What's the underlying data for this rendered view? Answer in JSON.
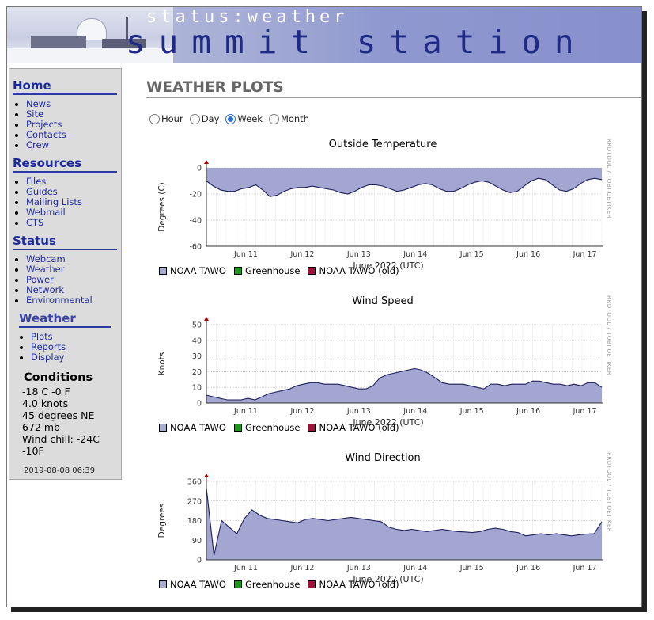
{
  "header": {
    "top_text": "status:weather",
    "main_text": "summit station"
  },
  "sidebar": {
    "home": {
      "title": "Home",
      "items": [
        "News",
        "Site",
        "Projects",
        "Contacts",
        "Crew"
      ]
    },
    "resources": {
      "title": "Resources",
      "items": [
        "Files",
        "Guides",
        "Mailing Lists",
        "Webmail",
        "CTS"
      ]
    },
    "status": {
      "title": "Status",
      "items": [
        "Webcam",
        "Weather",
        "Power",
        "Network",
        "Environmental"
      ]
    },
    "weather": {
      "title": "Weather",
      "items": [
        "Plots",
        "Reports",
        "Display"
      ]
    },
    "conditions": {
      "title": "Conditions",
      "lines": [
        "-18 C -0 F",
        "4.0 knots",
        "45 degrees NE",
        "672 mb",
        "Wind chill: -24C",
        "-10F"
      ],
      "date": "2019-08-08 06:39"
    }
  },
  "main": {
    "title": "WEATHER PLOTS",
    "ranges": [
      "Hour",
      "Day",
      "Week",
      "Month"
    ],
    "selected_range": "Week"
  },
  "legend": {
    "items": [
      "NOAA TAWO",
      "Greenhouse",
      "NOAA TAWO (old)"
    ],
    "colors": [
      "#a8acd0",
      "#1a9a1a",
      "#a0103a"
    ]
  },
  "watermark": "RRDTOOL / TOBI OETIKER",
  "colors": {
    "area": "#a3a6d1",
    "line": "#1c1f5c",
    "grid": "#d9d9d9"
  },
  "chart_data": [
    {
      "type": "area",
      "title": "Outside Temperature",
      "ylabel": "Degrees (C)",
      "xlabel": "June 2022 (UTC)",
      "categories": [
        "Jun 11",
        "Jun 12",
        "Jun 13",
        "Jun 14",
        "Jun 15",
        "Jun 16",
        "Jun 17"
      ],
      "yticks": [
        "0",
        "-20",
        "-40",
        "-60"
      ],
      "ylim": [
        -60,
        0
      ],
      "area_from": "top",
      "series": [
        {
          "name": "NOAA TAWO",
          "values": [
            -10,
            -14,
            -17,
            -18,
            -18,
            -16,
            -15,
            -13,
            -17,
            -22,
            -21,
            -18,
            -16,
            -15,
            -15,
            -14,
            -15,
            -16,
            -17,
            -19,
            -20,
            -18,
            -15,
            -13,
            -13,
            -14,
            -16,
            -18,
            -17,
            -15,
            -13,
            -12,
            -13,
            -16,
            -18,
            -18,
            -16,
            -13,
            -11,
            -10,
            -11,
            -14,
            -17,
            -19,
            -18,
            -14,
            -10,
            -8,
            -9,
            -13,
            -17,
            -18,
            -16,
            -12,
            -9,
            -8,
            -9
          ]
        }
      ]
    },
    {
      "type": "area",
      "title": "Wind Speed",
      "ylabel": "Knots",
      "xlabel": "June 2022 (UTC)",
      "categories": [
        "Jun 11",
        "Jun 12",
        "Jun 13",
        "Jun 14",
        "Jun 15",
        "Jun 16",
        "Jun 17"
      ],
      "yticks": [
        "50",
        "40",
        "30",
        "20",
        "10",
        "0"
      ],
      "ylim": [
        0,
        50
      ],
      "area_from": "bottom",
      "series": [
        {
          "name": "NOAA TAWO",
          "values": [
            5,
            4,
            3,
            2,
            2,
            2,
            3,
            2,
            4,
            6,
            7,
            8,
            9,
            11,
            12,
            13,
            13,
            12,
            12,
            12,
            11,
            10,
            9,
            9,
            11,
            16,
            18,
            19,
            20,
            21,
            22,
            21,
            19,
            16,
            13,
            12,
            12,
            12,
            11,
            10,
            9,
            12,
            12,
            11,
            12,
            12,
            12,
            14,
            14,
            13,
            12,
            12,
            11,
            12,
            11,
            13,
            13,
            10
          ]
        }
      ]
    },
    {
      "type": "area",
      "title": "Wind Direction",
      "ylabel": "Degrees",
      "xlabel": "June 2022 (UTC)",
      "categories": [
        "Jun 11",
        "Jun 12",
        "Jun 13",
        "Jun 14",
        "Jun 15",
        "Jun 16",
        "Jun 17"
      ],
      "yticks": [
        "360",
        "270",
        "180",
        "90",
        "0"
      ],
      "ylim": [
        0,
        360
      ],
      "area_from": "bottom",
      "series": [
        {
          "name": "NOAA TAWO",
          "values": [
            330,
            20,
            180,
            150,
            120,
            190,
            230,
            205,
            190,
            185,
            180,
            175,
            170,
            185,
            190,
            185,
            180,
            185,
            190,
            195,
            190,
            185,
            180,
            175,
            150,
            140,
            135,
            140,
            135,
            130,
            135,
            140,
            135,
            130,
            128,
            125,
            130,
            140,
            145,
            140,
            130,
            125,
            110,
            115,
            120,
            115,
            120,
            115,
            110,
            115,
            118,
            120,
            175
          ]
        }
      ]
    }
  ]
}
